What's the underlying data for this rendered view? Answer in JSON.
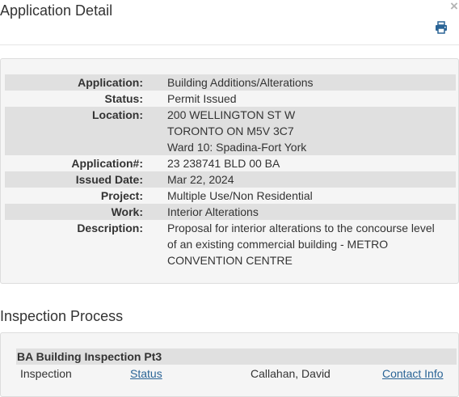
{
  "header": {
    "title": "Application Detail",
    "close_glyph": "×",
    "print_icon": "printer-icon"
  },
  "detail": {
    "rows": [
      {
        "label": "Application:",
        "lines": [
          "Building Additions/Alterations"
        ]
      },
      {
        "label": "Status:",
        "lines": [
          "Permit Issued"
        ]
      },
      {
        "label": "Location:",
        "lines": [
          "200 WELLINGTON ST W",
          "TORONTO ON M5V 3C7",
          "Ward 10: Spadina-Fort York"
        ]
      },
      {
        "label": "Application#:",
        "lines": [
          "23 238741 BLD 00 BA"
        ]
      },
      {
        "label": "Issued Date:",
        "lines": [
          "Mar 22, 2024"
        ]
      },
      {
        "label": "Project:",
        "lines": [
          "Multiple Use/Non Residential"
        ]
      },
      {
        "label": "Work:",
        "lines": [
          "Interior Alterations"
        ]
      },
      {
        "label": "Description:",
        "lines": [
          "Proposal for interior alterations to the concourse level",
          "of an existing commercial building - METRO",
          "CONVENTION CENTRE"
        ]
      }
    ]
  },
  "inspection": {
    "section_title": "Inspection Process",
    "group_title": "BA Building Inspection Pt3",
    "row": {
      "type": "Inspection",
      "status_link": "Status",
      "inspector": "Callahan, David",
      "contact_link": "Contact Info"
    }
  },
  "colors": {
    "panel_bg": "#f5f5f5",
    "row_shade": "#e0e0e0",
    "link": "#2a6496",
    "text": "#333333"
  }
}
